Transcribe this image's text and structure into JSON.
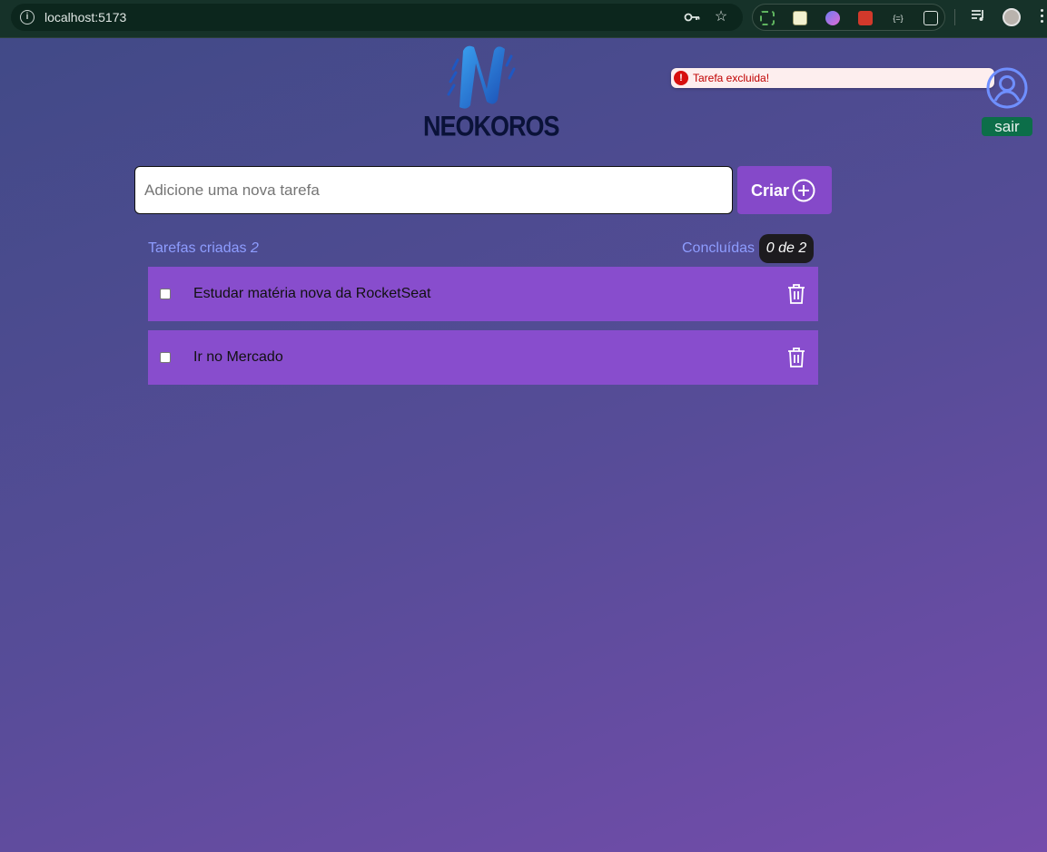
{
  "browser": {
    "url": "localhost:5173"
  },
  "header": {
    "logo_text": "NEOKOROS"
  },
  "toast": {
    "message": "Tarefa excluida!",
    "icon": "error-icon",
    "color": "#c00000"
  },
  "user": {
    "logout_label": "sair",
    "icon": "user-circle-icon"
  },
  "new_task": {
    "placeholder": "Adicione uma nova tarefa",
    "value": "",
    "create_label": "Criar",
    "create_icon": "plus-circle-icon"
  },
  "summary": {
    "created_label": "Tarefas criadas",
    "created_count": "2",
    "done_label": "Concluídas",
    "done_value": "0 de 2"
  },
  "tasks": [
    {
      "text": "Estudar matéria nova da RocketSeat",
      "done": false
    },
    {
      "text": "Ir no Mercado",
      "done": false
    }
  ],
  "colors": {
    "accent": "#8549c9",
    "task_bg": "#884dcd",
    "logout_bg": "#0c6e49",
    "counter_text": "#8e9dff"
  }
}
